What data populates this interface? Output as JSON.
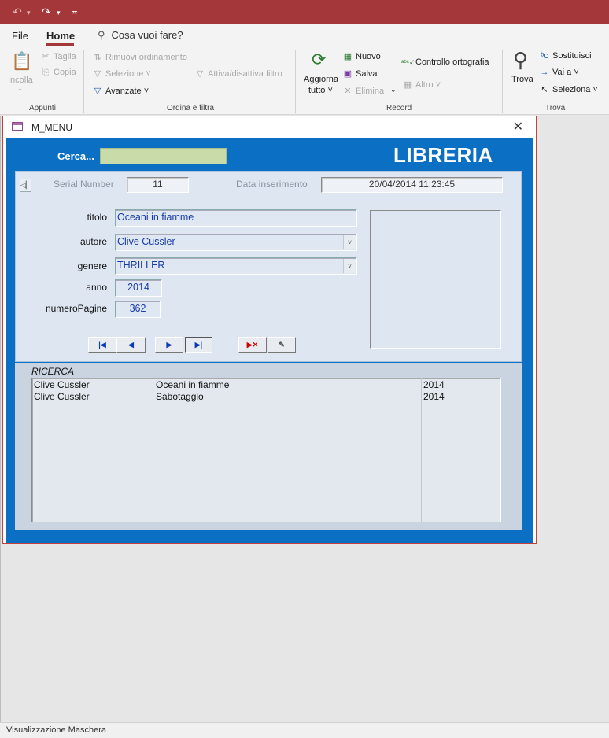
{
  "quick_access": {
    "undo": "↶",
    "redo": "↷"
  },
  "ribbon": {
    "tabs": [
      {
        "label": "File"
      },
      {
        "label": "Home"
      }
    ],
    "tell_me": "Cosa vuoi fare?",
    "appunti": {
      "incolla": "Incolla",
      "taglia": "Taglia",
      "copia": "Copia",
      "group": "Appunti"
    },
    "ordina": {
      "rimuovi": "Rimuovi ordinamento",
      "selezione": "Selezione",
      "avanzate": "Avanzate",
      "attiva": "Attiva/disattiva filtro",
      "group": "Ordina e filtra"
    },
    "record": {
      "aggiorna1": "Aggiorna",
      "aggiorna2": "tutto",
      "nuovo": "Nuovo",
      "salva": "Salva",
      "elimina": "Elimina",
      "controllo": "Controllo ortografia",
      "altro": "Altro",
      "group": "Record"
    },
    "trova": {
      "trova": "Trova",
      "sostituisci": "Sostituisci",
      "vai": "Vai a",
      "seleziona": "Seleziona",
      "group": "Trova"
    }
  },
  "form": {
    "window_title": "M_MENU",
    "cerca_label": "Cerca...",
    "cerca_value": "",
    "app_title": "LIBRERIA",
    "serial_label": "Serial Number",
    "serial_value": "11",
    "data_label": "Data inserimento",
    "data_value": "20/04/2014 11:23:45",
    "fields": {
      "titolo_label": "titolo",
      "titolo_value": "Oceani in fiamme",
      "autore_label": "autore",
      "autore_value": "Clive Cussler",
      "genere_label": "genere",
      "genere_value": "THRILLER",
      "anno_label": "anno",
      "anno_value": "2014",
      "pagine_label": "numeroPagine",
      "pagine_value": "362"
    },
    "results_label": "RICERCA",
    "results": [
      {
        "autore": "Clive Cussler",
        "titolo": "Oceani in fiamme",
        "anno": "2014"
      },
      {
        "autore": "Clive Cussler",
        "titolo": "Sabotaggio",
        "anno": "2014"
      }
    ]
  },
  "status": "Visualizzazione Maschera",
  "colors": {
    "title_bar": "#a4373a",
    "form_blue": "#0b6fc4",
    "cerca_green": "#c8dba8"
  }
}
